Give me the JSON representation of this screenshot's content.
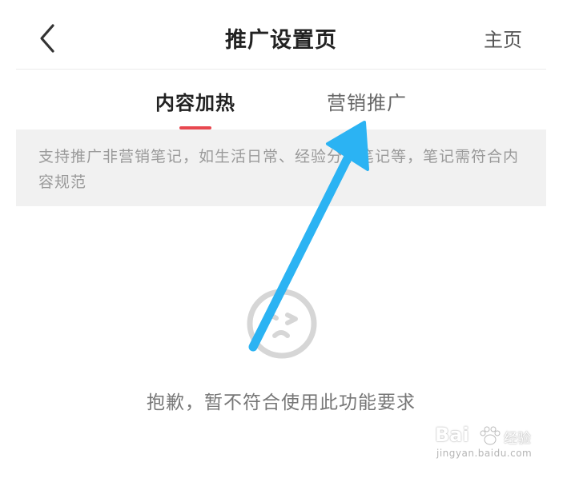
{
  "header": {
    "title": "推广设置页",
    "home_label": "主页",
    "back_icon": "chevron-left-icon"
  },
  "tabs": [
    {
      "label": "内容加热",
      "active": true
    },
    {
      "label": "营销推广",
      "active": false
    }
  ],
  "notice": {
    "text": "支持推广非营销笔记，如生活日常、经验分享笔记等，笔记需符合内容规范"
  },
  "empty_state": {
    "icon": "sad-face-icon",
    "message": "抱歉，暂不符合使用此功能要求"
  },
  "annotation": {
    "arrow_color": "#2bb3f3",
    "icon": "annotation-arrow-icon"
  },
  "watermark": {
    "brand": "Bai",
    "brand_cn": "经验",
    "url": "jingyan.baidu.com"
  },
  "colors": {
    "accent": "#e8474f",
    "notice_bg": "#f1f1f1",
    "title": "#222222",
    "muted": "#777777"
  }
}
